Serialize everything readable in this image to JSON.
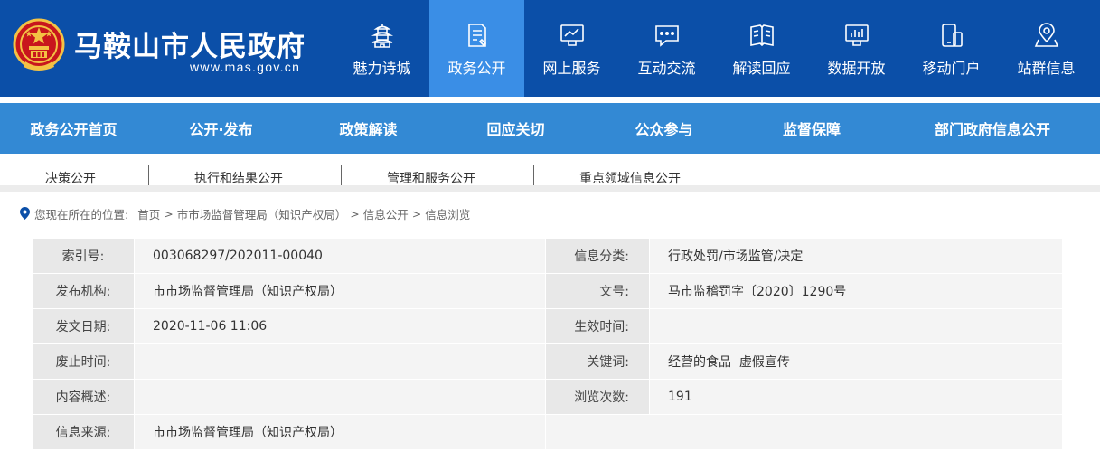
{
  "header": {
    "site_title": "马鞍山市人民政府",
    "site_url": "www.mas.gov.cn",
    "brand_color": "#0b4fa8",
    "active_color": "#3a8ee6",
    "nav": [
      {
        "label": "魅力诗城",
        "icon": "pagoda-icon"
      },
      {
        "label": "政务公开",
        "icon": "document-icon"
      },
      {
        "label": "网上服务",
        "icon": "monitor-icon"
      },
      {
        "label": "互动交流",
        "icon": "chat-icon"
      },
      {
        "label": "解读回应",
        "icon": "book-icon"
      },
      {
        "label": "数据开放",
        "icon": "data-screen-icon"
      },
      {
        "label": "移动门户",
        "icon": "mobile-icon"
      },
      {
        "label": "站群信息",
        "icon": "location-icon"
      }
    ],
    "active_nav": "政务公开"
  },
  "secondary_nav": {
    "items": [
      "政务公开首页",
      "公开·发布",
      "政策解读",
      "回应关切",
      "公众参与",
      "监督保障",
      "部门政府信息公开"
    ],
    "color": "#3389d4"
  },
  "sub_nav": {
    "items": [
      "决策公开",
      "执行和结果公开",
      "管理和服务公开",
      "重点领域信息公开"
    ]
  },
  "breadcrumb": {
    "prefix": "您现在所在的位置:",
    "items": [
      "首页",
      "市市场监督管理局（知识产权局）",
      "信息公开",
      "信息浏览"
    ],
    "separator": ">"
  },
  "info": {
    "rows": [
      {
        "l1": "索引号:",
        "v1": "003068297/202011-00040",
        "l2": "信息分类:",
        "v2": "行政处罚/市场监管/决定"
      },
      {
        "l1": "发布机构:",
        "v1": "市市场监督管理局（知识产权局）",
        "l2": "文号:",
        "v2": "马市监稽罚字〔2020〕1290号"
      },
      {
        "l1": "发文日期:",
        "v1": "2020-11-06 11:06",
        "l2": "生效时间:",
        "v2": ""
      },
      {
        "l1": "废止时间:",
        "v1": "",
        "l2": "关键词:",
        "v2": "经营的食品  虚假宣传"
      },
      {
        "l1": "内容概述:",
        "v1": "",
        "l2": "浏览次数:",
        "v2": "191"
      },
      {
        "l1": "信息来源:",
        "v1": "市市场监督管理局（知识产权局）",
        "l2": "",
        "v2": ""
      }
    ]
  }
}
